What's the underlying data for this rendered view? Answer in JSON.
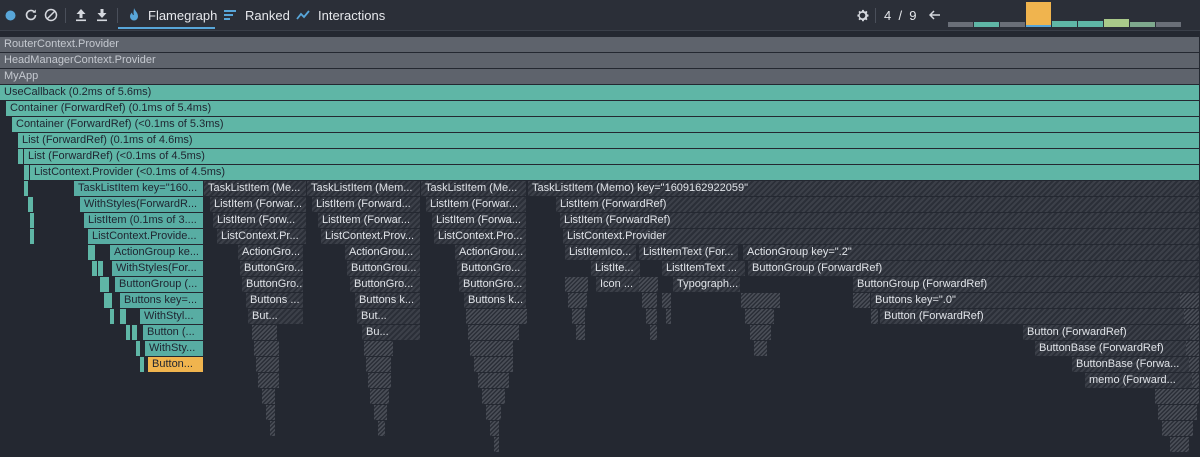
{
  "toolbar": {
    "tabs": [
      {
        "label": "Flamegraph",
        "icon": "flame-icon",
        "active": true
      },
      {
        "label": "Ranked",
        "icon": "ranked-icon",
        "active": false
      },
      {
        "label": "Interactions",
        "icon": "interactions-icon",
        "active": false
      }
    ],
    "commit_counter": "4  /  9",
    "commit_bars": [
      {
        "value": 0.2,
        "color": "#6a6f78"
      },
      {
        "value": 0.2,
        "color": "#5fb6a6"
      },
      {
        "value": 0.2,
        "color": "#6a6f78"
      },
      {
        "value": 1.0,
        "color": "#f0b44e",
        "selected": true
      },
      {
        "value": 0.25,
        "color": "#5fb6a6"
      },
      {
        "value": 0.25,
        "color": "#5fb6a6"
      },
      {
        "value": 0.3,
        "color": "#a9c98a"
      },
      {
        "value": 0.2,
        "color": "#7fa98e"
      },
      {
        "value": 0.2,
        "color": "#6a6f78"
      }
    ],
    "colors": {
      "accent": "#58a6d9",
      "record": "#58a6d9"
    }
  },
  "flamegraph": {
    "nodes": [
      {
        "label": "RouterContext.Provider",
        "style": "gray"
      },
      {
        "label": "HeadManagerContext.Provider",
        "style": "gray"
      },
      {
        "label": "MyApp",
        "style": "gray"
      },
      {
        "label": "UseCallback (0.2ms of 5.6ms)",
        "style": "teal"
      },
      {
        "label": "Container (ForwardRef) (0.1ms of 5.4ms)",
        "style": "teal"
      },
      {
        "label": "Container (ForwardRef) (<0.1ms of 5.3ms)",
        "style": "teal"
      },
      {
        "label": "List (ForwardRef) (0.1ms of 4.6ms)",
        "style": "teal"
      },
      {
        "label": "List (ForwardRef) (<0.1ms of 4.5ms)",
        "style": "teal"
      },
      {
        "label": "ListContext.Provider (<0.1ms of 4.5ms)",
        "style": "teal"
      },
      {
        "label": "TaskListItem key=\"160...",
        "style": "teal"
      },
      {
        "label": "WithStyles(ForwardR...",
        "style": "teal"
      },
      {
        "label": "ListItem (0.1ms of 3....",
        "style": "teal"
      },
      {
        "label": "ListContext.Provide...",
        "style": "teal"
      },
      {
        "label": "ActionGroup ke...",
        "style": "teal"
      },
      {
        "label": "WithStyles(For...",
        "style": "teal"
      },
      {
        "label": "ButtonGroup (...",
        "style": "teal"
      },
      {
        "label": "Buttons key=...",
        "style": "teal"
      },
      {
        "label": "WithStyl...",
        "style": "teal"
      },
      {
        "label": "Button (...",
        "style": "teal"
      },
      {
        "label": "WithSty...",
        "style": "teal"
      },
      {
        "label": "Button...",
        "style": "orange"
      },
      {
        "label": "TaskListItem (Me...",
        "style": "hatch"
      },
      {
        "label": "ListItem (Forwar...",
        "style": "hatch"
      },
      {
        "label": "ListItem (Forw...",
        "style": "hatch"
      },
      {
        "label": "ListContext.Pr...",
        "style": "hatch"
      },
      {
        "label": "ActionGro...",
        "style": "hatch"
      },
      {
        "label": "ButtonGro...",
        "style": "hatch"
      },
      {
        "label": "ButtonGro...",
        "style": "hatch"
      },
      {
        "label": "Buttons ...",
        "style": "hatch"
      },
      {
        "label": "But...",
        "style": "hatch"
      },
      {
        "label": "TaskListItem (Mem...",
        "style": "hatch"
      },
      {
        "label": "ListItem (Forward...",
        "style": "hatch"
      },
      {
        "label": "ListItem (Forwar...",
        "style": "hatch"
      },
      {
        "label": "ListContext.Prov...",
        "style": "hatch"
      },
      {
        "label": "ActionGrou...",
        "style": "hatch"
      },
      {
        "label": "ButtonGrou...",
        "style": "hatch"
      },
      {
        "label": "ButtonGro...",
        "style": "hatch"
      },
      {
        "label": "Buttons k...",
        "style": "hatch"
      },
      {
        "label": "But...",
        "style": "hatch"
      },
      {
        "label": "Bu...",
        "style": "hatch"
      },
      {
        "label": "TaskListItem (Me...",
        "style": "hatch"
      },
      {
        "label": "ListItem (Forwar...",
        "style": "hatch"
      },
      {
        "label": "ListItem (Forwa...",
        "style": "hatch"
      },
      {
        "label": "ListContext.Pro...",
        "style": "hatch"
      },
      {
        "label": "ActionGrou...",
        "style": "hatch"
      },
      {
        "label": "ButtonGro...",
        "style": "hatch"
      },
      {
        "label": "ButtonGro...",
        "style": "hatch"
      },
      {
        "label": "Buttons k...",
        "style": "hatch"
      },
      {
        "label": "TaskListItem (Memo) key=\"1609162922059\"",
        "style": "hatch"
      },
      {
        "label": "ListItem (ForwardRef)",
        "style": "hatch"
      },
      {
        "label": "ListItem (ForwardRef)",
        "style": "hatch"
      },
      {
        "label": "ListContext.Provider",
        "style": "hatch"
      },
      {
        "label": "ListItemIco...",
        "style": "hatch"
      },
      {
        "label": "ListItemText (For...",
        "style": "hatch"
      },
      {
        "label": "ActionGroup key=\".2\"",
        "style": "hatch"
      },
      {
        "label": "ListIte...",
        "style": "hatch"
      },
      {
        "label": "ListItemText ...",
        "style": "hatch"
      },
      {
        "label": "ButtonGroup (ForwardRef)",
        "style": "hatch"
      },
      {
        "label": "Icon ...",
        "style": "hatch"
      },
      {
        "label": "Typograph...",
        "style": "hatch"
      },
      {
        "label": "ButtonGroup (ForwardRef)",
        "style": "hatch"
      },
      {
        "label": "Buttons key=\".0\"",
        "style": "hatch"
      },
      {
        "label": "Button (ForwardRef)",
        "style": "hatch"
      },
      {
        "label": "Button (ForwardRef)",
        "style": "hatch"
      },
      {
        "label": "ButtonBase (ForwardRef)",
        "style": "hatch"
      },
      {
        "label": "ButtonBase (Forwa...",
        "style": "hatch"
      },
      {
        "label": "memo (Forward...",
        "style": "hatch"
      }
    ]
  }
}
